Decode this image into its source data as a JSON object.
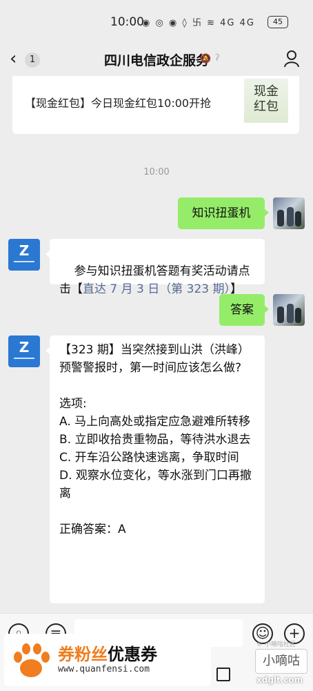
{
  "status": {
    "time": "10:00",
    "icons": "◉ ◎ ◉ ◊ 卐 ≋ 4G 4G",
    "battery": "45"
  },
  "header": {
    "title": "四川电信政企服务",
    "unread": "1"
  },
  "promo_card": {
    "text": "【现金红包】今日现金红包10:00开抢",
    "thumb_text": "现金红包"
  },
  "timestamp": "10:00",
  "messages": {
    "m1": {
      "text": "知识扭蛋机"
    },
    "m2": {
      "text_prefix": "参与知识扭蛋机答题有奖活动请点击【",
      "link": "直达 7 月 3 日（第 323 期）",
      "text_suffix": "】"
    },
    "m3": {
      "text": "答案"
    },
    "m4": {
      "text": "【323 期】当突然接到山洪（洪峰）预警警报时，第一时间应该怎么做?\n\n选项:\nA. 马上向高处或指定应急避难所转移\nB. 立即收拾贵重物品，等待洪水退去\nC. 开车沿公路快速逃离，争取时间\nD. 观察水位变化，等水涨到门口再撤离\n\n正确答案：A"
    }
  },
  "watermark": {
    "title_a": "券粉丝",
    "title_b": "优惠券",
    "url": "www.quanfensi.com",
    "badge": "小嘀咕",
    "site": "xdglt.com",
    "small": "© 小嘀咕社区"
  },
  "colors": {
    "bubble_out": "#95ec69",
    "link": "#576b95",
    "bot_avatar": "#2a78d2",
    "background": "#ededed"
  }
}
